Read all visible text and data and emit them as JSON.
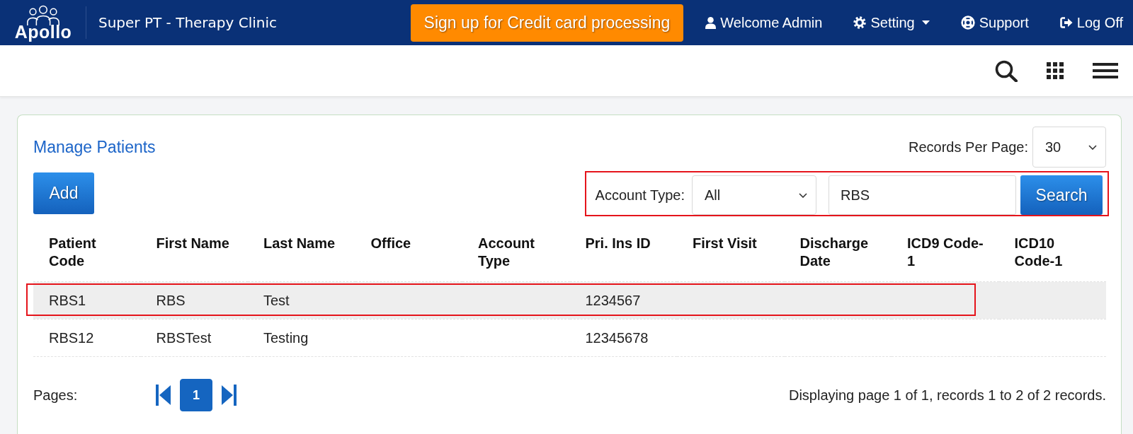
{
  "navbar": {
    "logo_text": "Apollo",
    "clinic_name": "Super PT - Therapy Clinic",
    "promo_button": "Sign up for Credit card processing",
    "links": [
      {
        "kind": "user",
        "label": "Welcome Admin",
        "dropdown": false
      },
      {
        "kind": "settings",
        "label": "Setting",
        "dropdown": true
      },
      {
        "kind": "support",
        "label": "Support",
        "dropdown": false
      },
      {
        "kind": "logout",
        "label": "Log Off",
        "dropdown": false
      }
    ]
  },
  "panel": {
    "title": "Manage Patients",
    "records_per_page": {
      "label": "Records Per Page:",
      "value": "30"
    },
    "add_button": "Add",
    "filter": {
      "marked": true,
      "label": "Account Type:",
      "account_type": "All",
      "search_text": "RBS",
      "search_button": "Search"
    }
  },
  "table": {
    "columns": [
      "Patient Code",
      "First Name",
      "Last Name",
      "Office",
      "Account Type",
      "Pri. Ins ID",
      "First Visit",
      "Discharge Date",
      "ICD9 Code-1",
      "ICD10 Code-1"
    ],
    "rows": [
      {
        "selected": true,
        "marked": true,
        "cells": [
          "RBS1",
          "RBS",
          "Test",
          null,
          null,
          "1234567",
          null,
          null,
          null,
          null
        ]
      },
      {
        "selected": false,
        "marked": false,
        "cells": [
          "RBS12",
          "RBSTest",
          "Testing",
          null,
          null,
          "12345678",
          null,
          null,
          null,
          null
        ]
      }
    ]
  },
  "pagination": {
    "label": "Pages:",
    "pages": [
      {
        "label": "1",
        "selected": true
      }
    ],
    "summary": "Displaying page 1 of 1, records 1 to 2 of 2 records."
  }
}
